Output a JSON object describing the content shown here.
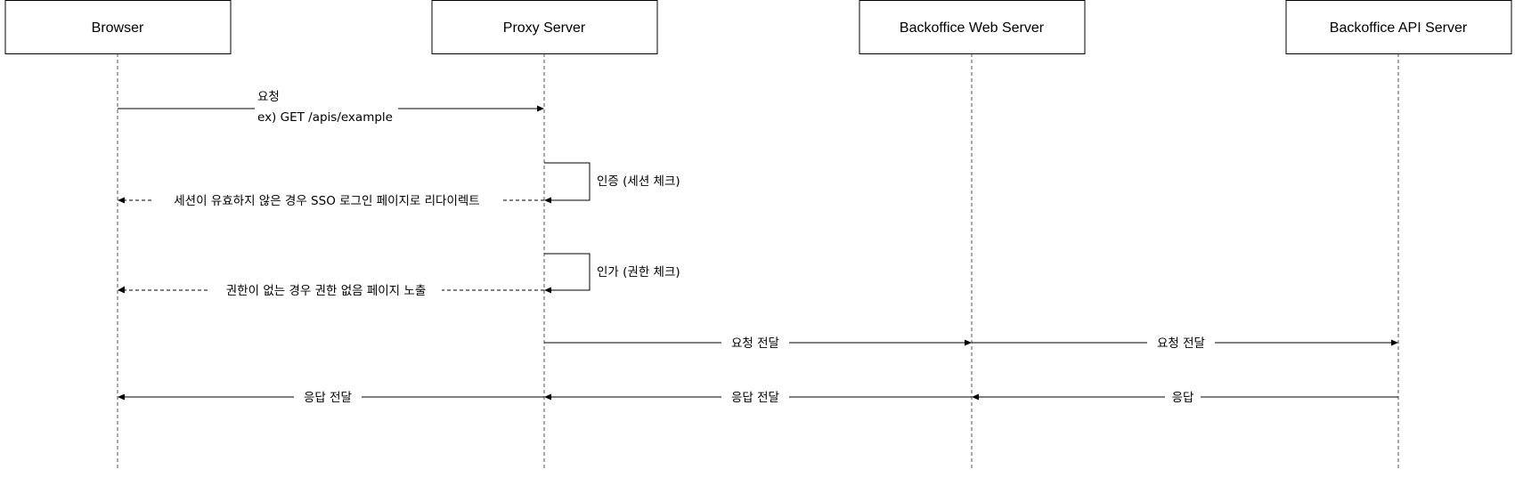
{
  "colors": {
    "background": "#ffffff",
    "line": "#000000",
    "lifeline": "#555555"
  },
  "actors": [
    {
      "label": "Browser"
    },
    {
      "label": "Proxy Server"
    },
    {
      "label": "Backoffice Web Server"
    },
    {
      "label": "Backoffice API Server"
    }
  ],
  "messages": [
    {
      "from": 0,
      "to": 1,
      "style": "solid",
      "lines": [
        "요청",
        "ex) GET /apis/example"
      ]
    },
    {
      "from": 1,
      "to": 1,
      "style": "self",
      "lines": [
        "인증 (세션 체크)"
      ]
    },
    {
      "from": 1,
      "to": 0,
      "style": "dashed",
      "lines": [
        "세션이 유효하지 않은 경우 SSO 로그인 페이지로 리다이렉트"
      ]
    },
    {
      "from": 1,
      "to": 1,
      "style": "self",
      "lines": [
        "인가 (권한 체크)"
      ]
    },
    {
      "from": 1,
      "to": 0,
      "style": "dashed",
      "lines": [
        "권한이 없는 경우 권한 없음 페이지 노출"
      ]
    },
    {
      "from": 1,
      "to": 2,
      "style": "solid",
      "lines": [
        "요청 전달"
      ]
    },
    {
      "from": 2,
      "to": 3,
      "style": "solid",
      "lines": [
        "요청 전달"
      ]
    },
    {
      "from": 1,
      "to": 0,
      "style": "solid",
      "lines": [
        "응답 전달"
      ]
    },
    {
      "from": 2,
      "to": 1,
      "style": "solid",
      "lines": [
        "응답 전달"
      ]
    },
    {
      "from": 3,
      "to": 2,
      "style": "solid",
      "lines": [
        "응답"
      ]
    }
  ]
}
